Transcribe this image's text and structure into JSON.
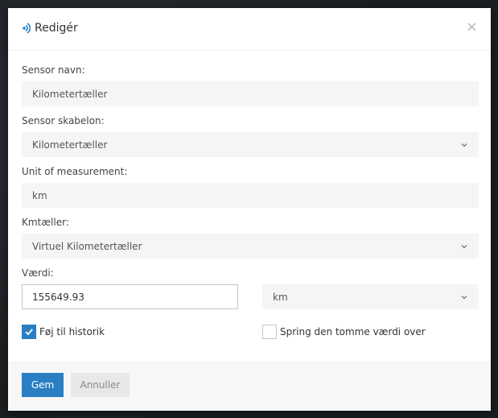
{
  "modal": {
    "title": "Redigér",
    "close_symbol": "×"
  },
  "form": {
    "sensor_name": {
      "label": "Sensor navn:",
      "value": "Kilometertæller"
    },
    "sensor_template": {
      "label": "Sensor skabelon:",
      "value": "Kilometertæller"
    },
    "unit_of_measurement": {
      "label": "Unit of measurement:",
      "value": "km"
    },
    "odometer": {
      "label": "Kmtæller:",
      "value": "Virtuel Kilometertæller"
    },
    "value": {
      "label": "Værdi:",
      "value": "155649.93",
      "unit": "km"
    },
    "add_to_history": {
      "label": "Føj til historik",
      "checked": true
    },
    "skip_empty_value": {
      "label": "Spring den tomme værdi over",
      "checked": false
    }
  },
  "footer": {
    "save_label": "Gem",
    "cancel_label": "Annuller"
  },
  "icons": {
    "title": "sensor-signal-icon",
    "close": "close-icon",
    "chevron": "chevron-down-icon",
    "check": "checkmark-icon"
  },
  "colors": {
    "primary": "#2a7fc3",
    "field_bg": "#f5f5f5",
    "footer_bg": "#f7f7f7"
  }
}
